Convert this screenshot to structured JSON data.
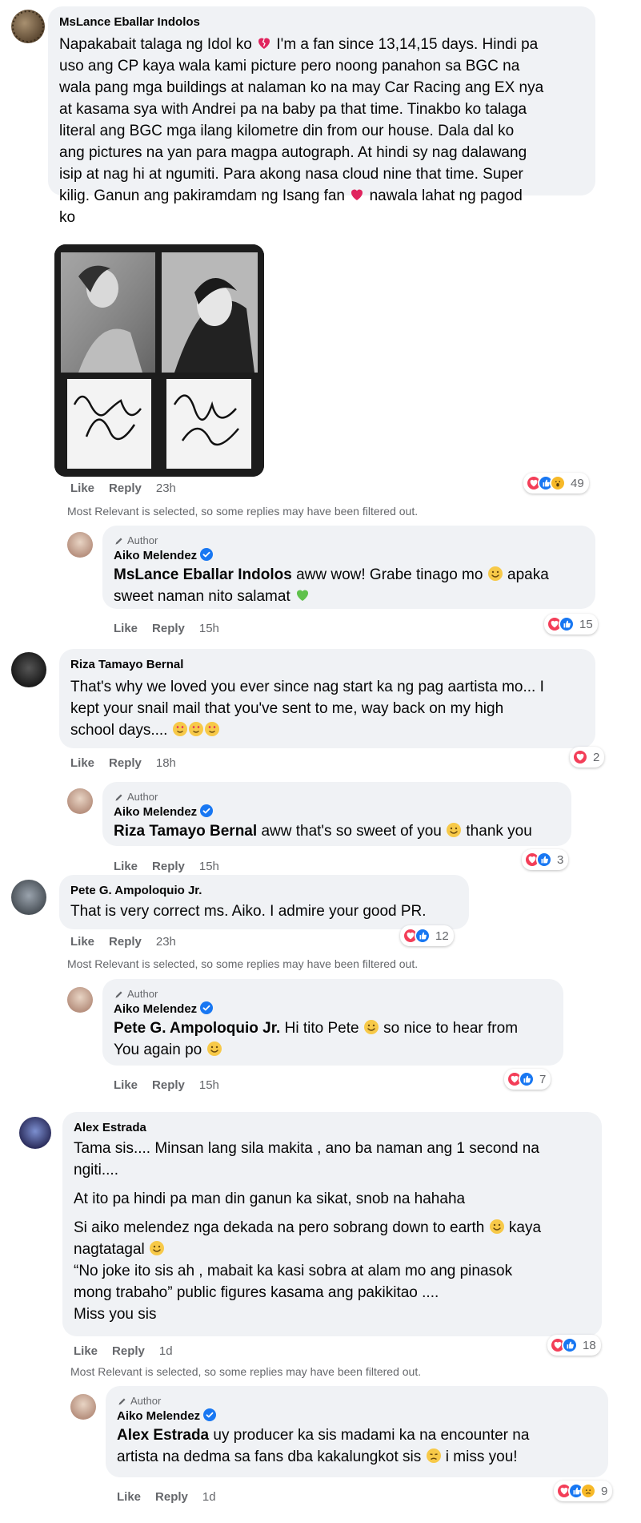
{
  "colors": {
    "bubble": "#f0f2f5",
    "love": "#f33e58",
    "like": "#1877f2",
    "verified": "#1877f2",
    "muted": "#65676b"
  },
  "labels": {
    "like": "Like",
    "reply": "Reply",
    "author": "Author"
  },
  "filter_note": "Most Relevant is selected, so some replies may have been filtered out.",
  "comments": [
    {
      "name": "MsLance Eballar Indolos",
      "text_lines": [
        "Napakabait talaga ng Idol ko",
        "I'm a fan since 13,14,15 days. Hindi pa",
        "uso ang CP kaya wala kami picture pero noong panahon sa BGC na",
        "wala pang mga buildings at nalaman ko na may Car Racing ang EX nya",
        "at kasama sya with Andrei pa na baby pa that time. Tinakbo ko talaga",
        "literal ang BGC mga ilang kilometre din from our house. Dala dal ko",
        "ang pictures na yan para magpa autograph. At hindi sy nag dalawang",
        "isip at nag hi at ngumiti. Para akong nasa cloud nine that time. Super",
        "kilig. Ganun ang pakiramdam ng Isang fan",
        "nawala lahat ng pagod",
        "ko"
      ],
      "time": "23h",
      "reaction_count": "49",
      "reply": {
        "name": "Aiko Melendez",
        "mention": "MsLance Eballar Indolos",
        "text_a": "aww wow! Grabe tinago mo",
        "text_b": "apaka",
        "text_c": "sweet naman nito salamat",
        "time": "15h",
        "reaction_count": "15"
      }
    },
    {
      "name": "Riza Tamayo Bernal",
      "text_lines": [
        "That's why we loved you ever since nag start ka ng pag aartista mo... I",
        "kept your snail mail that you've sent to me, way back on my high",
        "school days...."
      ],
      "time": "18h",
      "reaction_count": "2",
      "reply": {
        "name": "Aiko Melendez",
        "mention": "Riza Tamayo Bernal",
        "text_a": "aww that's so sweet of you",
        "text_b": "thank you",
        "time": "15h",
        "reaction_count": "3"
      }
    },
    {
      "name": "Pete G. Ampoloquio Jr.",
      "text_lines": [
        "That is very correct ms. Aiko. I admire your good PR."
      ],
      "time": "23h",
      "reaction_count": "12",
      "reply": {
        "name": "Aiko Melendez",
        "mention": "Pete G. Ampoloquio Jr.",
        "text_a": "Hi tito Pete",
        "text_b": "so nice to hear from",
        "text_c": "You again po",
        "time": "15h",
        "reaction_count": "7"
      }
    },
    {
      "name": "Alex Estrada",
      "paras": [
        [
          "Tama sis.... Minsan lang sila makita , ano ba naman ang 1 second na",
          "ngiti...."
        ],
        [
          "At ito pa hindi pa man din ganun ka sikat, snob na hahaha"
        ],
        [
          "Si aiko melendez nga dekada na pero sobrang down to earth",
          "kaya",
          "nagtatagal"
        ],
        [
          "“No joke ito sis ah , mabait ka kasi sobra at alam mo ang pinasok",
          "mong trabaho” public figures kasama ang pakikitao ....",
          "Miss you sis"
        ]
      ],
      "time": "1d",
      "reaction_count": "18",
      "reply": {
        "name": "Aiko Melendez",
        "mention": "Alex Estrada",
        "text_a": "uy producer ka sis madami ka na encounter na",
        "text_b": "artista na dedma sa fans dba kakalungkot sis",
        "text_c": "i miss you!",
        "time": "1d",
        "reaction_count": "9"
      }
    }
  ]
}
